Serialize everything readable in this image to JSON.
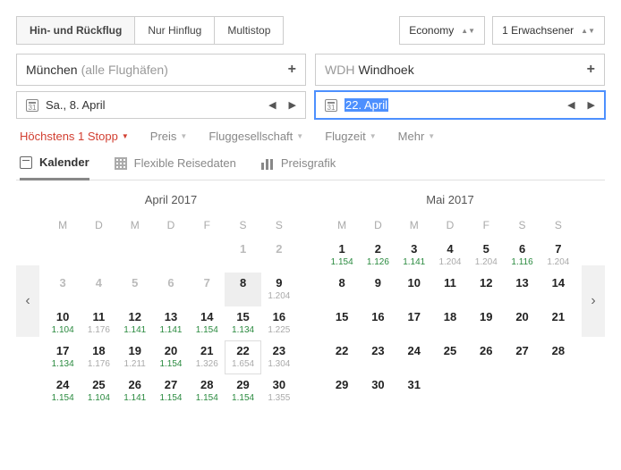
{
  "tripTypes": [
    "Hin- und Rückflug",
    "Nur Hinflug",
    "Multistop"
  ],
  "tripTypeActive": 0,
  "cabin": "Economy",
  "passengers": "1 Erwachsener",
  "origin": {
    "main": "München",
    "sub": "(alle Flughäfen)"
  },
  "destination": {
    "code": "WDH",
    "city": "Windhoek"
  },
  "departDate": "Sa., 8. April",
  "returnDate": "22. April",
  "calIconNum": "31",
  "filters": {
    "stops": "Höchstens 1 Stopp",
    "price": "Preis",
    "airline": "Fluggesellschaft",
    "time": "Flugzeit",
    "more": "Mehr"
  },
  "viewTabs": {
    "calendar": "Kalender",
    "flexible": "Flexible Reisedaten",
    "priceChart": "Preisgrafik"
  },
  "months": [
    {
      "title": "April 2017",
      "dow": [
        "M",
        "D",
        "M",
        "D",
        "F",
        "S",
        "S"
      ],
      "leading": 5,
      "days": [
        {
          "d": 1,
          "dim": true
        },
        {
          "d": 2,
          "dim": true
        },
        {
          "d": 3,
          "dim": true
        },
        {
          "d": 4,
          "dim": true
        },
        {
          "d": 5,
          "dim": true
        },
        {
          "d": 6,
          "dim": true
        },
        {
          "d": 7,
          "dim": true
        },
        {
          "d": 8,
          "solid": true
        },
        {
          "d": 9,
          "price": "1.204",
          "pc": "grey"
        },
        {
          "d": 10,
          "price": "1.104",
          "pc": "green"
        },
        {
          "d": 11,
          "price": "1.176",
          "pc": "grey"
        },
        {
          "d": 12,
          "price": "1.141",
          "pc": "green"
        },
        {
          "d": 13,
          "price": "1.141",
          "pc": "green"
        },
        {
          "d": 14,
          "price": "1.154",
          "pc": "green"
        },
        {
          "d": 15,
          "price": "1.134",
          "pc": "green"
        },
        {
          "d": 16,
          "price": "1.225",
          "pc": "grey"
        },
        {
          "d": 17,
          "price": "1.134",
          "pc": "green"
        },
        {
          "d": 18,
          "price": "1.176",
          "pc": "grey"
        },
        {
          "d": 19,
          "price": "1.211",
          "pc": "grey"
        },
        {
          "d": 20,
          "price": "1.154",
          "pc": "green"
        },
        {
          "d": 21,
          "price": "1.326",
          "pc": "grey"
        },
        {
          "d": 22,
          "price": "1.654",
          "pc": "grey",
          "boxed": true
        },
        {
          "d": 23,
          "price": "1.304",
          "pc": "grey"
        },
        {
          "d": 24,
          "price": "1.154",
          "pc": "green"
        },
        {
          "d": 25,
          "price": "1.104",
          "pc": "green"
        },
        {
          "d": 26,
          "price": "1.141",
          "pc": "green"
        },
        {
          "d": 27,
          "price": "1.154",
          "pc": "green"
        },
        {
          "d": 28,
          "price": "1.154",
          "pc": "green"
        },
        {
          "d": 29,
          "price": "1.154",
          "pc": "green"
        },
        {
          "d": 30,
          "price": "1.355",
          "pc": "grey"
        }
      ]
    },
    {
      "title": "Mai 2017",
      "dow": [
        "M",
        "D",
        "M",
        "D",
        "F",
        "S",
        "S"
      ],
      "leading": 0,
      "days": [
        {
          "d": 1,
          "price": "1.154",
          "pc": "green"
        },
        {
          "d": 2,
          "price": "1.126",
          "pc": "green"
        },
        {
          "d": 3,
          "price": "1.141",
          "pc": "green"
        },
        {
          "d": 4,
          "price": "1.204",
          "pc": "grey"
        },
        {
          "d": 5,
          "price": "1.204",
          "pc": "grey"
        },
        {
          "d": 6,
          "price": "1.116",
          "pc": "green"
        },
        {
          "d": 7,
          "price": "1.204",
          "pc": "grey"
        },
        {
          "d": 8
        },
        {
          "d": 9
        },
        {
          "d": 10
        },
        {
          "d": 11
        },
        {
          "d": 12
        },
        {
          "d": 13
        },
        {
          "d": 14
        },
        {
          "d": 15
        },
        {
          "d": 16
        },
        {
          "d": 17
        },
        {
          "d": 18
        },
        {
          "d": 19
        },
        {
          "d": 20
        },
        {
          "d": 21
        },
        {
          "d": 22
        },
        {
          "d": 23
        },
        {
          "d": 24
        },
        {
          "d": 25
        },
        {
          "d": 26
        },
        {
          "d": 27
        },
        {
          "d": 28
        },
        {
          "d": 29
        },
        {
          "d": 30
        },
        {
          "d": 31
        }
      ]
    }
  ],
  "navPrev": "‹",
  "navNext": "›",
  "datePrev": "◀",
  "dateNext": "▶",
  "plus": "+"
}
